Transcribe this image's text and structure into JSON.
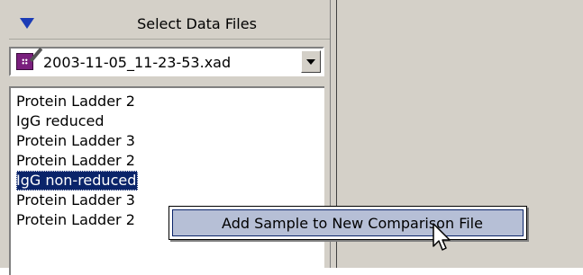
{
  "panel": {
    "title": "Select Data Files",
    "collapse_icon": "triangle-down-icon"
  },
  "file_select": {
    "selected_value": "2003-11-05_11-23-53.xad",
    "file_icon": "data-file-icon",
    "dropdown_icon": "chevron-down-icon"
  },
  "sample_list": {
    "items": [
      {
        "label": "Protein Ladder 2",
        "selected": false
      },
      {
        "label": "IgG reduced",
        "selected": false
      },
      {
        "label": "Protein Ladder 3",
        "selected": false
      },
      {
        "label": "Protein Ladder 2",
        "selected": false
      },
      {
        "label": "IgG non-reduced",
        "selected": true
      },
      {
        "label": "Protein Ladder 3",
        "selected": false
      },
      {
        "label": "Protein Ladder 2",
        "selected": false
      }
    ]
  },
  "context_menu": {
    "items": [
      {
        "label": "Add Sample to New Comparison File"
      }
    ]
  },
  "colors": {
    "selection_bg": "#0a246a",
    "menu_highlight": "#b6bfd6",
    "panel_bg": "#d4d0c8",
    "header_triangle": "#1b3bb6"
  }
}
